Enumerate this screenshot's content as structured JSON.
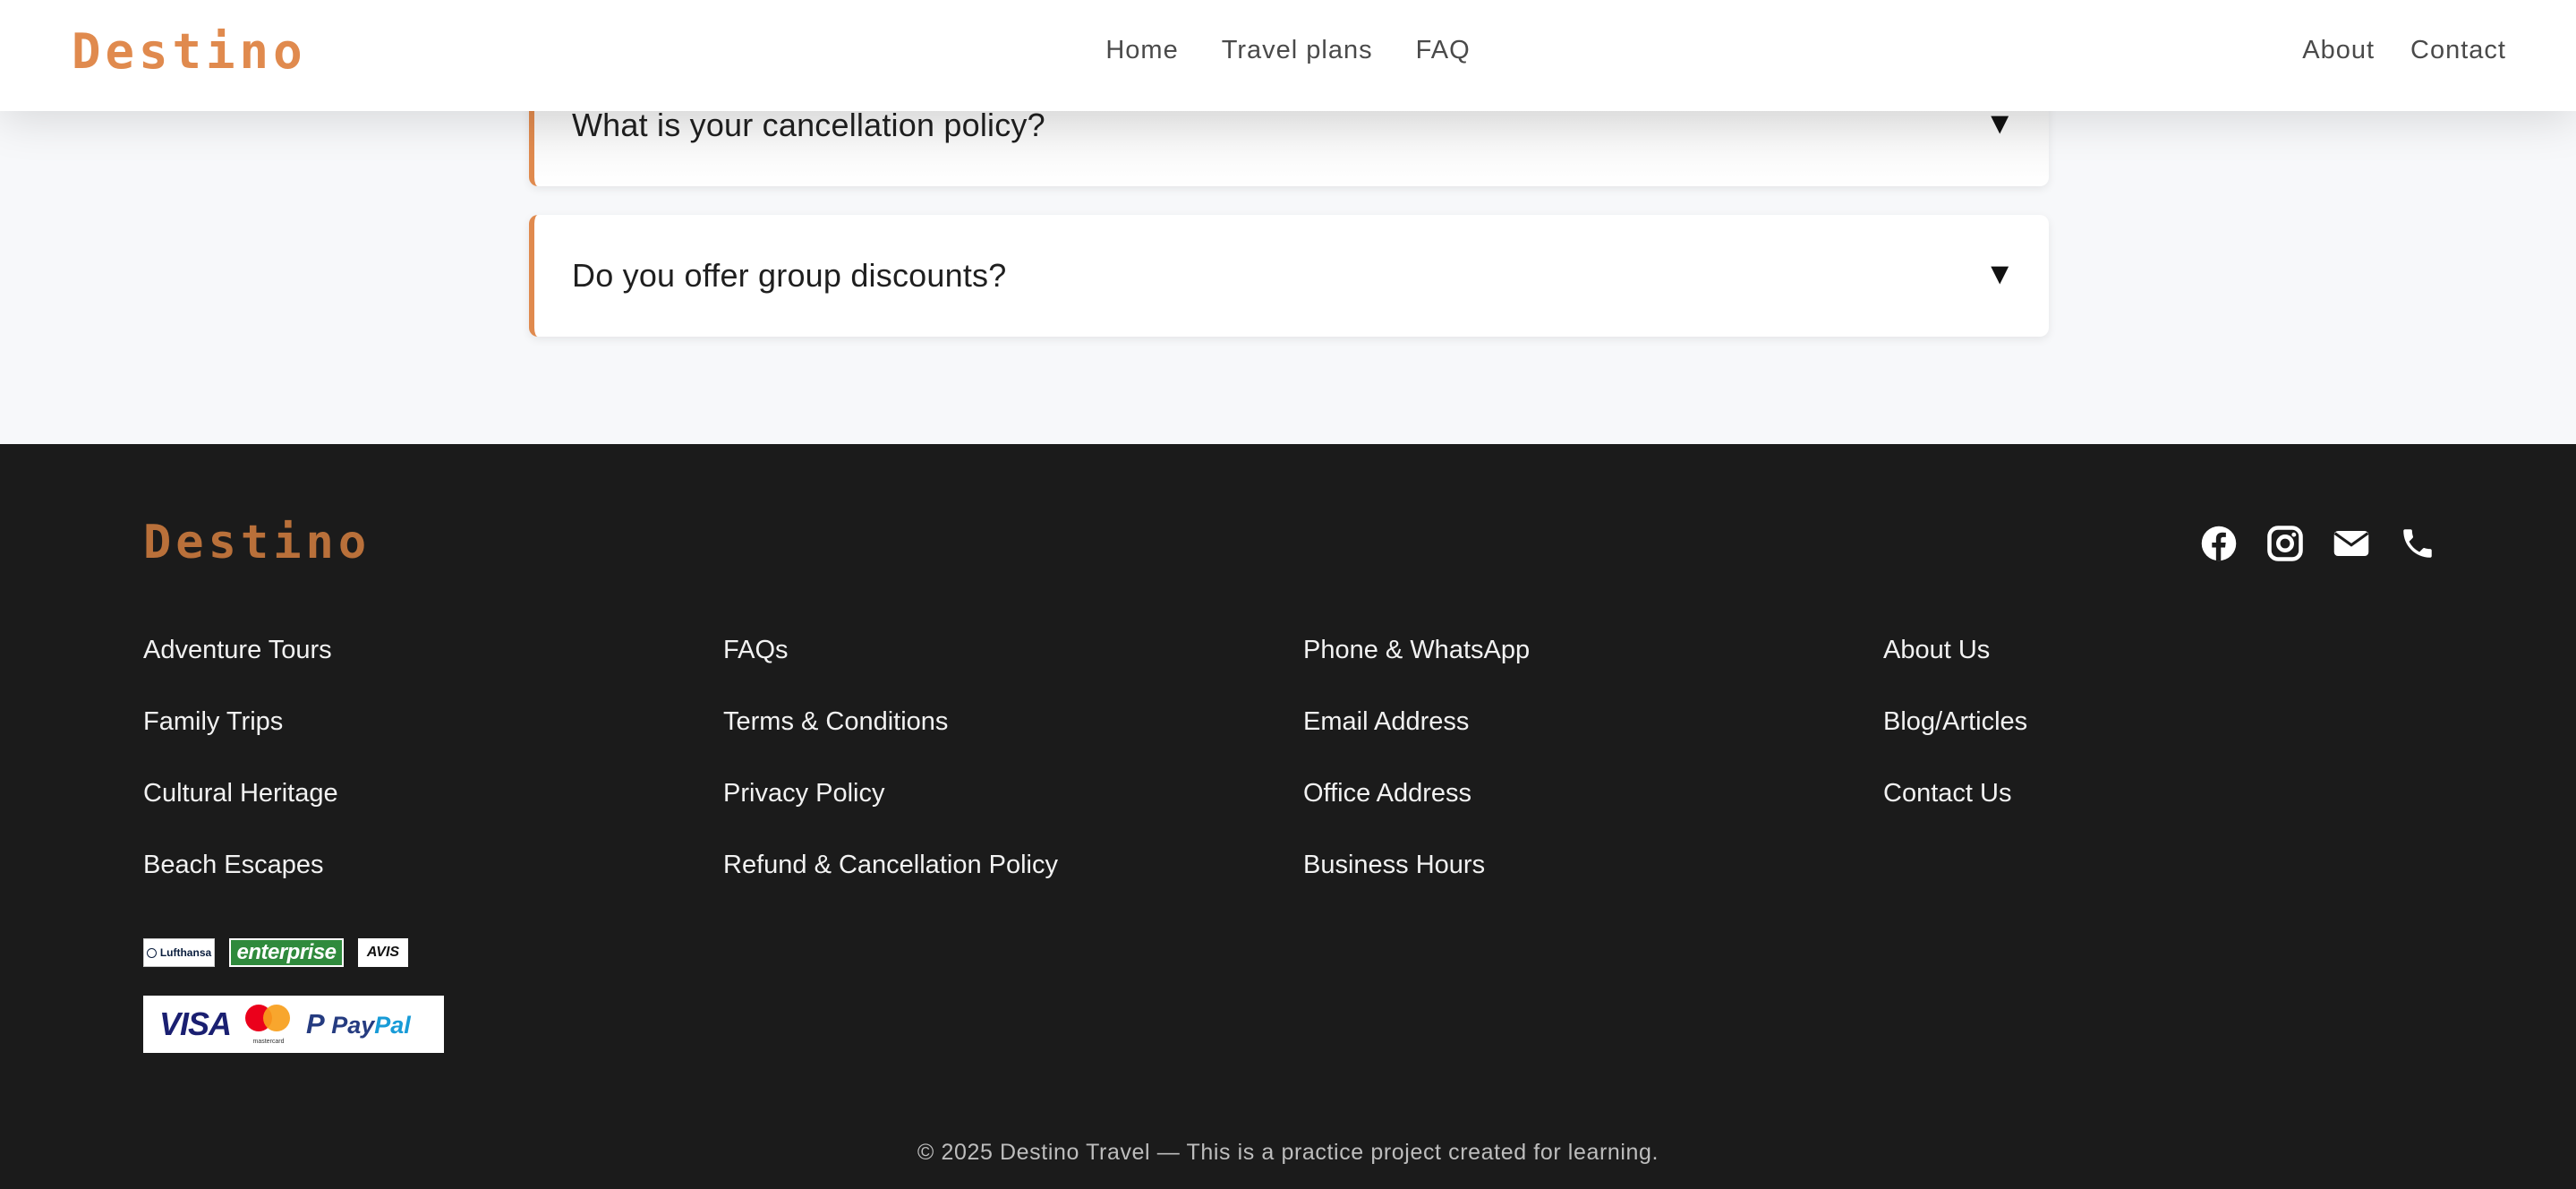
{
  "header": {
    "brand": "Destino",
    "nav_center": [
      "Home",
      "Travel plans",
      "FAQ"
    ],
    "nav_right": [
      "About",
      "Contact"
    ]
  },
  "faq": {
    "items": [
      {
        "question": "What is your cancellation policy?",
        "toggle": "▼"
      },
      {
        "question": "Do you offer group discounts?",
        "toggle": "▼"
      }
    ]
  },
  "footer": {
    "brand": "Destino",
    "socials": [
      "facebook-icon",
      "instagram-icon",
      "envelope-icon",
      "phone-icon"
    ],
    "columns": [
      [
        "Adventure Tours",
        "Family Trips",
        "Cultural Heritage",
        "Beach Escapes"
      ],
      [
        "FAQs",
        "Terms & Conditions",
        "Privacy Policy",
        "Refund & Cancellation Policy"
      ],
      [
        "Phone & WhatsApp",
        "Email Address",
        "Office Address",
        "Business Hours"
      ],
      [
        "About Us",
        "Blog/Articles",
        "Contact Us"
      ]
    ],
    "partners": [
      "Lufthansa",
      "enterprise",
      "AVIS"
    ],
    "payments": {
      "visa": "VISA",
      "mastercard": "mastercard",
      "paypal_pay": "Pay",
      "paypal_pal": "Pal",
      "paypal_icon": "P"
    },
    "copyright": "© 2025 Destino Travel — This is a practice project created for learning."
  },
  "colors": {
    "accent": "#e08a4e",
    "footer_brand": "#b9703a",
    "footer_bg": "#1b1b1b",
    "page_bg": "#f7f8fa"
  }
}
